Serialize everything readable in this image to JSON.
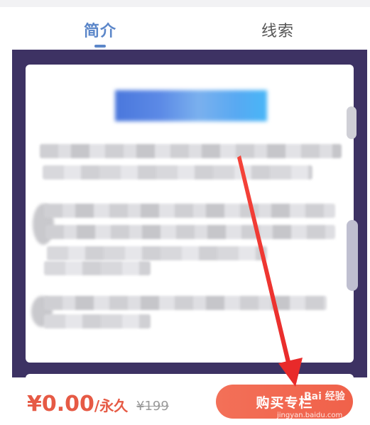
{
  "tabs": {
    "intro": "简介",
    "clues": "线索"
  },
  "footer": {
    "price": "¥0.00",
    "period": "/永久",
    "original_price": "¥199",
    "buy_label": "购买专栏"
  },
  "watermark": {
    "logo": "Bai 经验",
    "url": "jingyan.baidu.com"
  },
  "colors": {
    "accent": "#5b86c9",
    "price": "#e65a45",
    "button": "#f0614a",
    "panel": "#3d3263"
  }
}
